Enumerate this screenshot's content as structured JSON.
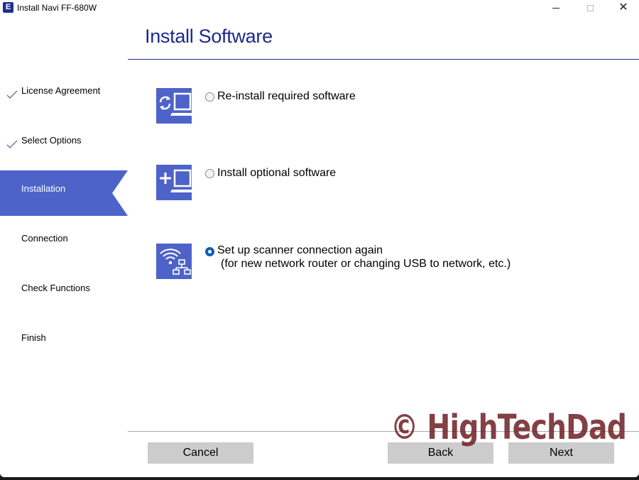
{
  "window": {
    "title": "Install Navi FF-680W",
    "app_icon_glyph": "E",
    "controls": {
      "minimize": "minimize",
      "maximize": "maximize",
      "close": "✕"
    }
  },
  "header": {
    "title": "Install Software"
  },
  "sidebar": {
    "steps": [
      {
        "label": "License Agreement",
        "status": "completed",
        "icon": "check-icon"
      },
      {
        "label": "Select Options",
        "status": "completed",
        "icon": "check-icon"
      },
      {
        "label": "Installation",
        "status": "active"
      },
      {
        "label": "Connection",
        "status": "pending"
      },
      {
        "label": "Check Functions",
        "status": "pending"
      },
      {
        "label": "Finish",
        "status": "pending"
      }
    ]
  },
  "options": [
    {
      "icon": "reinstall-computer-icon",
      "label": "Re-install required software",
      "sublabel": "",
      "selected": false
    },
    {
      "icon": "add-computer-icon",
      "label": "Install optional software",
      "sublabel": "",
      "selected": false
    },
    {
      "icon": "wifi-network-icon",
      "label": "Set up scanner connection again",
      "sublabel": "(for new network router or changing USB to network, etc.)",
      "selected": true
    }
  ],
  "footer": {
    "cancel_label": "Cancel",
    "back_label": "Back",
    "next_label": "Next"
  },
  "watermark": {
    "text": "© HighTechDad"
  },
  "colors": {
    "accent": "#4d63c9",
    "title": "#1a2a8c",
    "radio_selected": "#0d5db8",
    "button_bg": "#cccccc"
  }
}
